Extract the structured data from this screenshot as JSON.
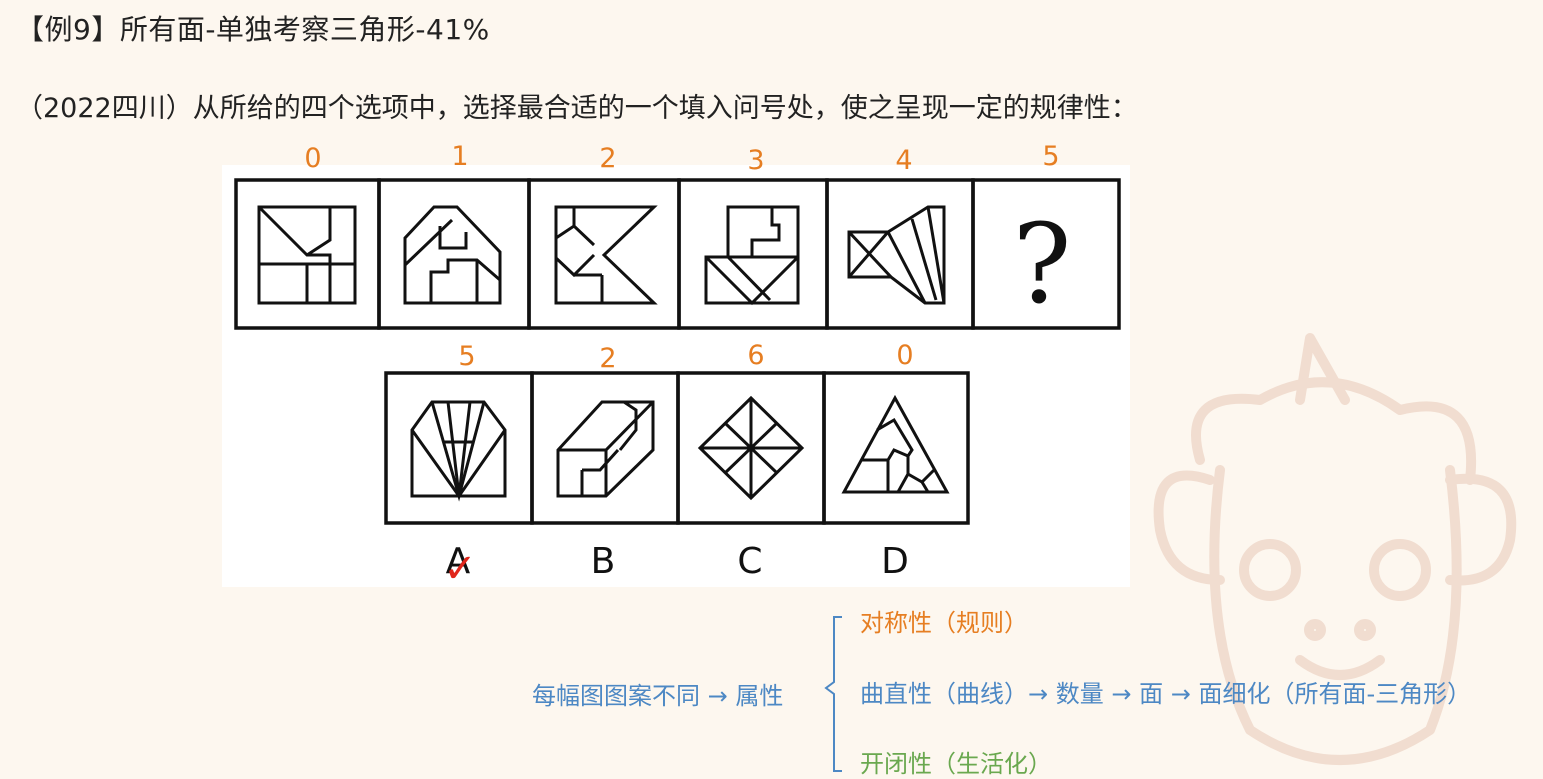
{
  "title": "【例9】所有面-单独考察三角形-41%",
  "question": "（2022四川）从所给的四个选项中，选择最合适的一个填入问号处，使之呈现一定的规律性：",
  "sequence_counts": [
    "0",
    "1",
    "2",
    "3",
    "4",
    "5"
  ],
  "option_counts": [
    "5",
    "2",
    "6",
    "0"
  ],
  "option_labels": [
    "A",
    "B",
    "C",
    "D"
  ],
  "question_mark": "?",
  "correct_mark": "✓",
  "analysis": {
    "left": "每幅图图案不同 → 属性",
    "branch_symmetry": "对称性（规则）",
    "branch_curve": "曲直性（曲线）→ 数量 → 面 → 面细化（所有面-三角形）",
    "branch_open": "开闭性（生活化）"
  },
  "colors": {
    "accent_orange": "#e67e22",
    "analysis_blue": "#4d88c4",
    "analysis_green": "#6aa84f",
    "check_red": "#e0261b"
  }
}
